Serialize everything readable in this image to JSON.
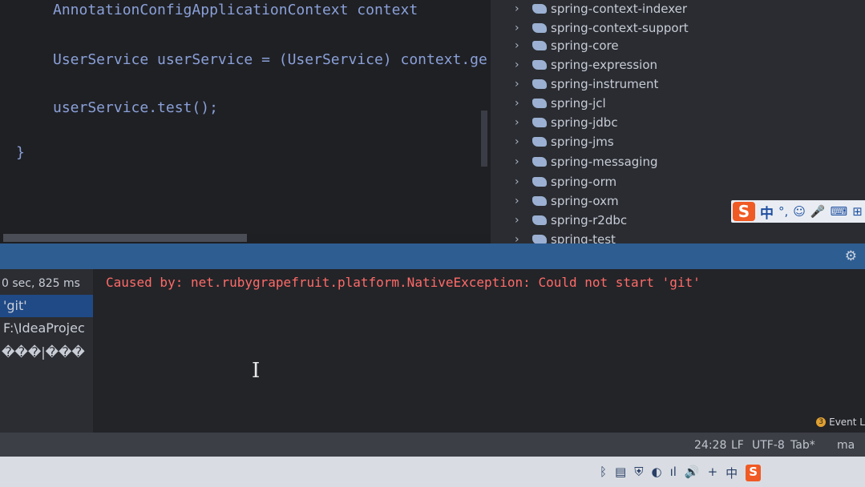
{
  "editor": {
    "lines": [
      "AnnotationConfigApplicationContext context",
      "UserService userService = (UserService) context.ge",
      "userService.test();",
      "}"
    ]
  },
  "project_tree": {
    "items": [
      "spring-context-indexer",
      "spring-context-support",
      "spring-core",
      "spring-expression",
      "spring-instrument",
      "spring-jcl",
      "spring-jdbc",
      "spring-jms",
      "spring-messaging",
      "spring-orm",
      "spring-oxm",
      "spring-r2dbc",
      "spring-test"
    ],
    "chevron": "›",
    "lib_icon": "gradle-module-icon"
  },
  "ime_toolbar": {
    "logo": "S",
    "mode": "中",
    "punct": "°,",
    "emoji": "☺",
    "mic": "🎤",
    "keyboard": "⌨",
    "skin": "⊞"
  },
  "build_panel": {
    "gear": "⚙",
    "side": {
      "duration": "0 sec, 825 ms",
      "selected": "'git'",
      "path": "F:\\IdeaProjec",
      "garbled": "���|���"
    },
    "error_text": "Caused by: net.rubygrapefruit.platform.NativeException: Could not start 'git'",
    "event_log": "Event L",
    "event_badge": "3"
  },
  "status_bar": {
    "position": "24:28",
    "line_sep": "LF",
    "encoding": "UTF-8",
    "indent": "Tab*",
    "branch": "ma"
  },
  "taskbar": {
    "tray_icons": [
      "ᛒ",
      "▤",
      "⛨",
      "◐",
      "ıl",
      "🔊",
      "+",
      "中",
      "S"
    ]
  },
  "colors": {
    "error": "#ff6b68",
    "accent": "#2e5d92",
    "code": "#8aa0d8"
  }
}
